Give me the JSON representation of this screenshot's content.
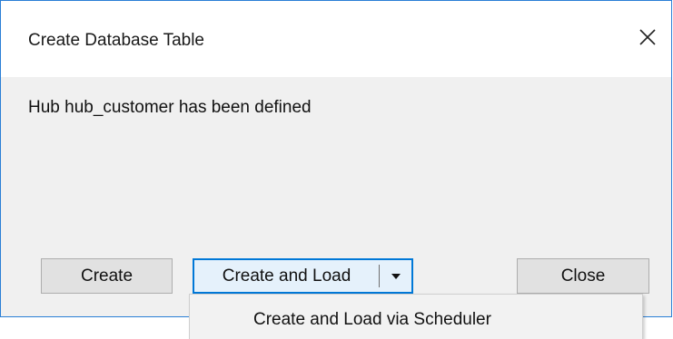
{
  "dialog": {
    "title": "Create Database Table",
    "message": "Hub hub_customer has been defined",
    "close_icon": "close-icon"
  },
  "buttons": {
    "create": "Create",
    "create_and_load": "Create and Load",
    "dropdown_icon": "caret-down-icon",
    "close": "Close"
  },
  "dropdown": {
    "items": [
      "Create and Load via Scheduler"
    ]
  },
  "colors": {
    "accent": "#0078d7",
    "window_border": "#2a7fd6",
    "dialog_bg": "#f0f0f0",
    "button_bg": "#e1e1e1"
  }
}
